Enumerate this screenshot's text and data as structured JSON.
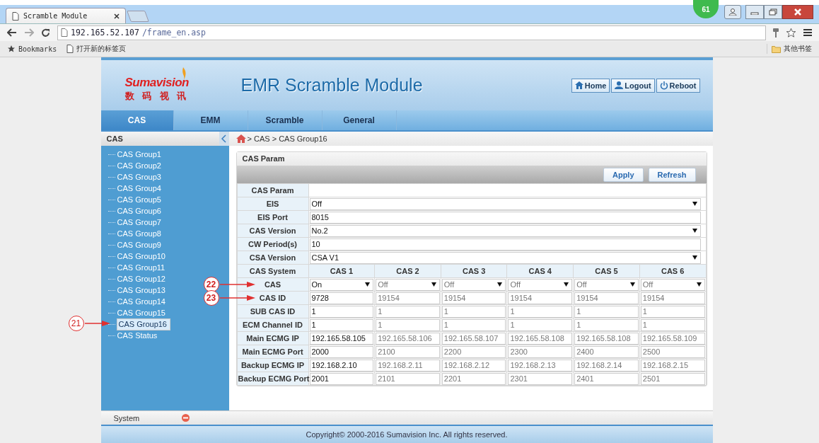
{
  "browser": {
    "tab_title": "Scramble Module",
    "address_host": "192.165.52.107",
    "address_path": "/frame_en.asp",
    "bookmarks": [
      "Bookmarks",
      "打开新的标签页"
    ],
    "other_bookmarks": "其他书签",
    "badge": "61"
  },
  "header": {
    "logo_name": "Sumavision",
    "logo_sub": "数 码 视 讯",
    "title": "EMR Scramble Module",
    "buttons": [
      {
        "label": "Home",
        "kind": "home"
      },
      {
        "label": "Logout",
        "kind": "user"
      },
      {
        "label": "Reboot",
        "kind": "power"
      }
    ]
  },
  "tabs": [
    {
      "label": "CAS",
      "selected": true
    },
    {
      "label": "EMM",
      "selected": false
    },
    {
      "label": "Scramble",
      "selected": false
    },
    {
      "label": "General",
      "selected": false
    }
  ],
  "sidebar": {
    "heading": "CAS",
    "items": [
      {
        "label": "CAS Group1",
        "selected": false
      },
      {
        "label": "CAS Group2",
        "selected": false
      },
      {
        "label": "CAS Group3",
        "selected": false
      },
      {
        "label": "CAS Group4",
        "selected": false
      },
      {
        "label": "CAS Group5",
        "selected": false
      },
      {
        "label": "CAS Group6",
        "selected": false
      },
      {
        "label": "CAS Group7",
        "selected": false
      },
      {
        "label": "CAS Group8",
        "selected": false
      },
      {
        "label": "CAS Group9",
        "selected": false
      },
      {
        "label": "CAS Group10",
        "selected": false
      },
      {
        "label": "CAS Group11",
        "selected": false
      },
      {
        "label": "CAS Group12",
        "selected": false
      },
      {
        "label": "CAS Group13",
        "selected": false
      },
      {
        "label": "CAS Group14",
        "selected": false
      },
      {
        "label": "CAS Group15",
        "selected": false
      },
      {
        "label": "CAS Group16",
        "selected": true,
        "callout": "21"
      },
      {
        "label": "CAS Status",
        "selected": false
      }
    ],
    "footer": "System"
  },
  "breadcrumb": "> CAS > CAS Group16",
  "panel": {
    "title": "CAS Param",
    "buttons": [
      "Apply",
      "Refresh"
    ],
    "params": [
      {
        "label": "CAS Param",
        "kind": "blank"
      },
      {
        "label": "EIS",
        "kind": "select",
        "value": "Off"
      },
      {
        "label": "EIS Port",
        "kind": "input",
        "value": "8015"
      },
      {
        "label": "CAS Version",
        "kind": "select",
        "value": "No.2"
      },
      {
        "label": "CW Period(s)",
        "kind": "input",
        "value": "10"
      },
      {
        "label": "CSA Version",
        "kind": "select",
        "value": "CSA V1"
      }
    ],
    "grid_label": "CAS System",
    "columns": [
      {
        "name": "CAS 1",
        "disabled": false
      },
      {
        "name": "CAS 2",
        "disabled": true
      },
      {
        "name": "CAS 3",
        "disabled": true
      },
      {
        "name": "CAS 4",
        "disabled": true
      },
      {
        "name": "CAS 5",
        "disabled": true
      },
      {
        "name": "CAS 6",
        "disabled": true
      }
    ],
    "rows": [
      {
        "label": "CAS",
        "kind": "select",
        "callout": "22",
        "values": [
          "On",
          "Off",
          "Off",
          "Off",
          "Off",
          "Off"
        ]
      },
      {
        "label": "CAS ID",
        "kind": "input",
        "callout": "23",
        "values": [
          "9728",
          "19154",
          "19154",
          "19154",
          "19154",
          "19154"
        ]
      },
      {
        "label": "SUB CAS ID",
        "kind": "input",
        "values": [
          "1",
          "1",
          "1",
          "1",
          "1",
          "1"
        ]
      },
      {
        "label": "ECM Channel ID",
        "kind": "input",
        "values": [
          "1",
          "1",
          "1",
          "1",
          "1",
          "1"
        ]
      },
      {
        "label": "Main ECMG IP",
        "kind": "input",
        "values": [
          "192.165.58.105",
          "192.165.58.106",
          "192.165.58.107",
          "192.165.58.108",
          "192.165.58.108",
          "192.165.58.109"
        ]
      },
      {
        "label": "Main ECMG Port",
        "kind": "input",
        "values": [
          "2000",
          "2100",
          "2200",
          "2300",
          "2400",
          "2500"
        ]
      },
      {
        "label": "Backup ECMG IP",
        "kind": "input",
        "values": [
          "192.168.2.10",
          "192.168.2.11",
          "192.168.2.12",
          "192.168.2.13",
          "192.168.2.14",
          "192.168.2.15"
        ]
      },
      {
        "label": "Backup ECMG Port",
        "kind": "input",
        "values": [
          "2001",
          "2101",
          "2201",
          "2301",
          "2401",
          "2501"
        ]
      }
    ]
  },
  "copyright": "Copyright© 2000-2016 Sumavision Inc. All rights reserved."
}
